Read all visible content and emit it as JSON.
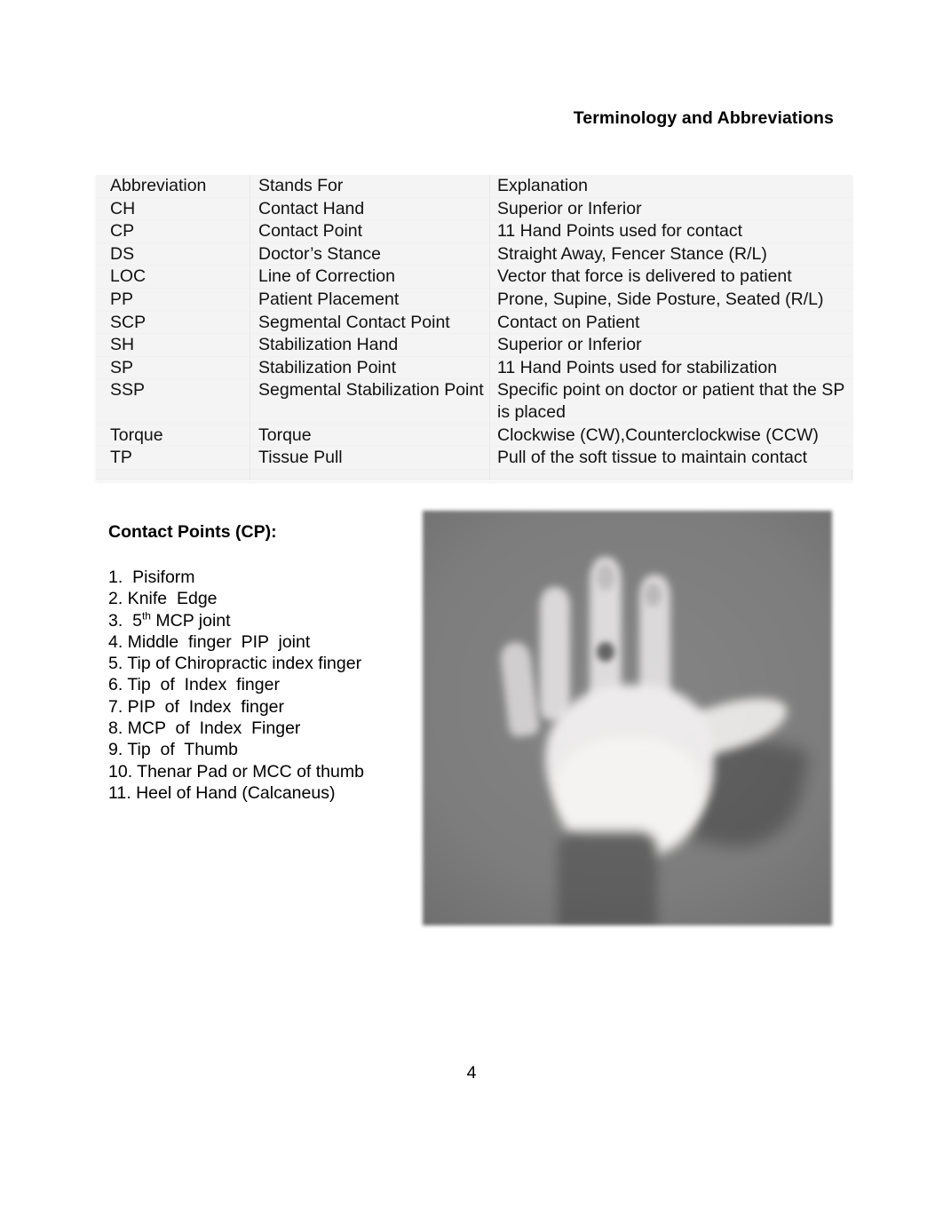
{
  "header": {
    "title": "Terminology and Abbreviations"
  },
  "abbreviation_table": {
    "columns": [
      "Abbreviation",
      "Stands For",
      "Explanation"
    ],
    "rows": [
      {
        "abbreviation": "Abbreviation",
        "stands_for": "Stands For",
        "explanation": "Explanation"
      },
      {
        "abbreviation": "CH",
        "stands_for": "Contact Hand",
        "explanation": "Superior or Inferior"
      },
      {
        "abbreviation": "CP",
        "stands_for": "Contact Point",
        "explanation": "11 Hand Points used for contact"
      },
      {
        "abbreviation": "DS",
        "stands_for": "Doctor’s Stance",
        "explanation": "Straight Away, Fencer Stance (R/L)"
      },
      {
        "abbreviation": "LOC",
        "stands_for": "Line of Correction",
        "explanation": "Vector that force is delivered to patient"
      },
      {
        "abbreviation": "PP",
        "stands_for": "Patient Placement",
        "explanation": "Prone, Supine, Side Posture, Seated (R/L)"
      },
      {
        "abbreviation": "SCP",
        "stands_for": "Segmental Contact Point",
        "explanation": "Contact on Patient"
      },
      {
        "abbreviation": "SH",
        "stands_for": "Stabilization Hand",
        "explanation": "Superior or Inferior"
      },
      {
        "abbreviation": "SP",
        "stands_for": "Stabilization Point",
        "explanation": "11 Hand Points used for stabilization"
      },
      {
        "abbreviation": "SSP",
        "stands_for": "Segmental Stabilization Point",
        "explanation": "Specific point on doctor or patient that the SP is placed"
      },
      {
        "abbreviation": "Torque",
        "stands_for": "Torque",
        "explanation": "Clockwise (CW),Counterclockwise (CCW)"
      },
      {
        "abbreviation": "TP",
        "stands_for": "Tissue Pull",
        "explanation": "Pull of the soft tissue to maintain contact"
      }
    ]
  },
  "contact_points": {
    "heading": "Contact Points (CP):",
    "items": [
      {
        "number": "1.",
        "text": "  Pisiform"
      },
      {
        "number": "2.",
        "text": " Knife  Edge"
      },
      {
        "number": "3.",
        "text": "  5",
        "sup": "th",
        "text_after": " MCP joint"
      },
      {
        "number": "4.",
        "text": " Middle  finger  PIP  joint"
      },
      {
        "number": "5.",
        "text": " Tip of Chiropractic index finger"
      },
      {
        "number": "6.",
        "text": " Tip  of  Index  finger"
      },
      {
        "number": "7.",
        "text": " PIP  of  Index  finger"
      },
      {
        "number": "8.",
        "text": " MCP  of  Index  Finger"
      },
      {
        "number": "9.",
        "text": " Tip  of  Thumb"
      },
      {
        "number": "10.",
        "text": " Thenar Pad or MCC of thumb"
      },
      {
        "number": "11.",
        "text": " Heel of Hand (Calcaneus)"
      }
    ]
  },
  "figure": {
    "alt": "Grayscale photograph of an open right hand, palm facing the camera, against a gray background"
  },
  "footer": {
    "page_number": "4"
  },
  "colors": {
    "page_background": "#ffffff",
    "table_background": "#f4f4f4",
    "table_divider": "#e7e7e7",
    "text": "#000000",
    "photo_background": "#7d7d7d"
  }
}
